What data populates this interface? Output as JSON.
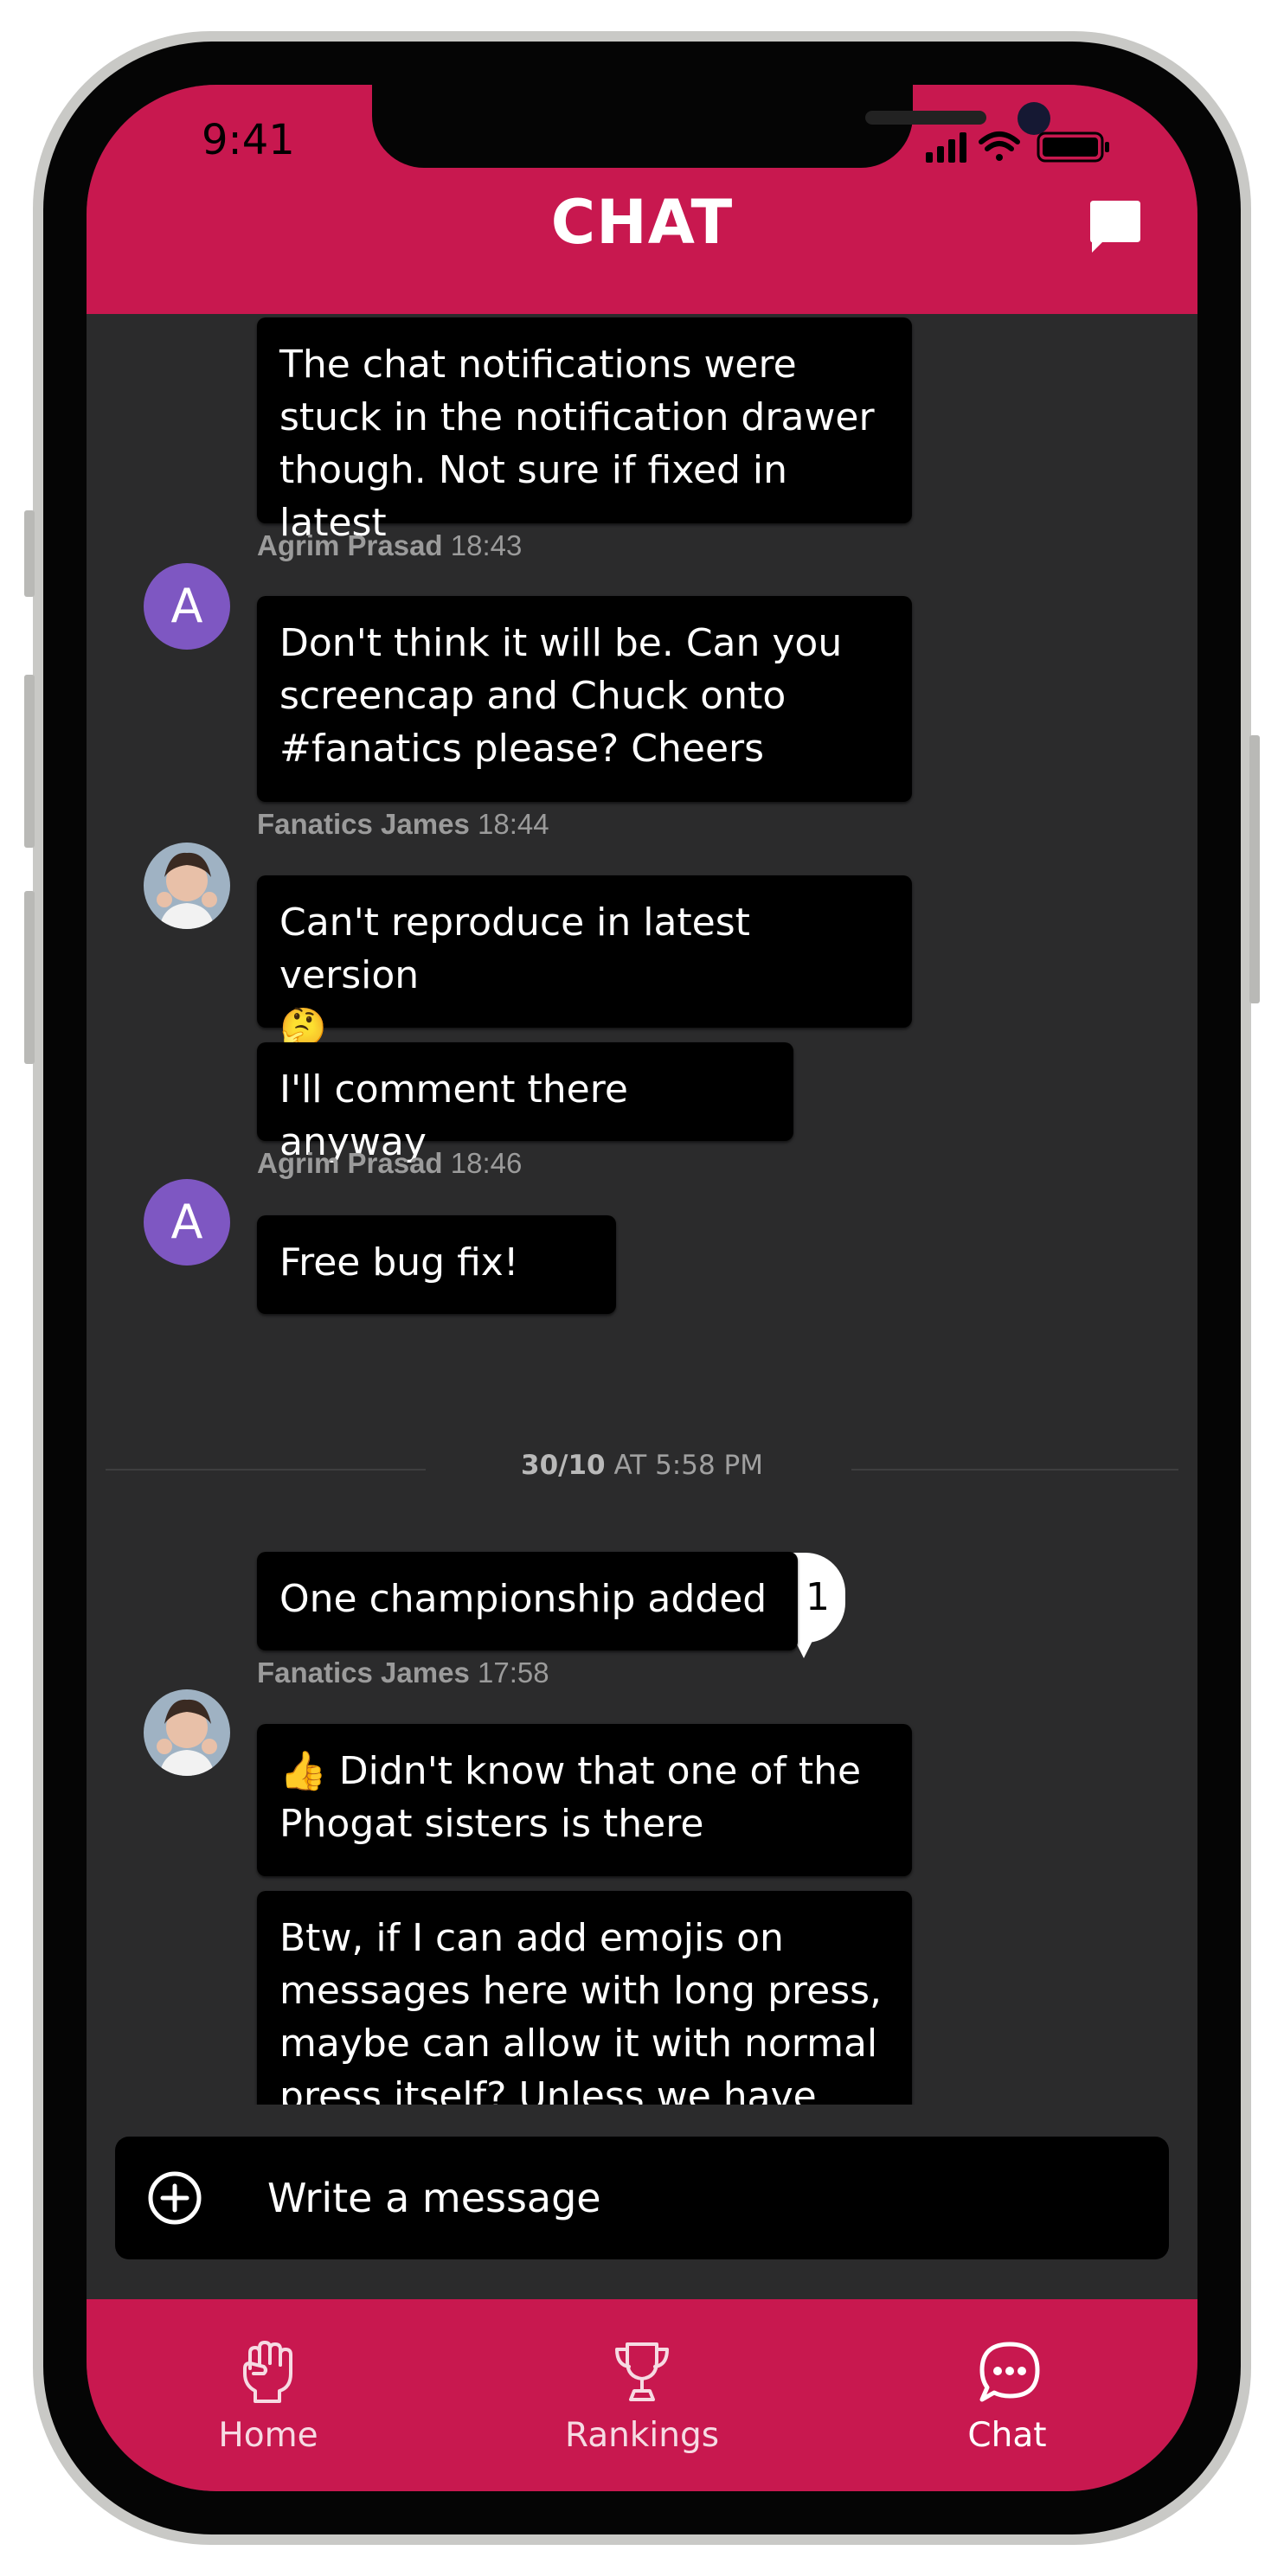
{
  "status_bar": {
    "time": "9:41"
  },
  "header": {
    "title": "CHAT",
    "compose_icon": "chat-bubble-icon"
  },
  "messages": [
    {
      "text": "The chat notifications were stuck in the notification drawer though. Not sure if fixed in latest",
      "lines": [
        "The chat notifications were",
        "stuck in the notification drawer",
        "though. Not sure if fixed in latest"
      ]
    },
    {
      "text": "Don't think it will be. Can you screencap and Chuck onto #fanatics please? Cheers",
      "lines": [
        "Don't think it will be. Can you",
        "screencap and Chuck onto",
        "#fanatics please? Cheers"
      ]
    },
    {
      "text": "Can't reproduce in latest version 🤔",
      "lines": [
        "Can't reproduce in latest version",
        "🤔"
      ]
    },
    {
      "text": "I'll comment there anyway"
    },
    {
      "text": "Free bug fix!"
    },
    {
      "text": "One championship added"
    },
    {
      "text": "👍 Didn't know that one of the Phogat sisters is there",
      "lines": [
        "👍 Didn't know that one of the",
        "Phogat sisters is there"
      ]
    },
    {
      "text": "Btw, if I can add emojis on messages here with long press, maybe can allow it with normal press itself? Unless we have",
      "lines": [
        "Btw, if I can add emojis on",
        "messages here with long press,",
        "maybe can allow it with normal",
        "press itself? Unless we have"
      ]
    }
  ],
  "senders": [
    {
      "name": "Agrim Prasad",
      "time": "18:43",
      "avatar_letter": "A"
    },
    {
      "name": "Fanatics James",
      "time": "18:44",
      "avatar": "user-photo"
    },
    {
      "name": "Agrim Prasad",
      "time": "18:46",
      "avatar_letter": "A"
    },
    {
      "name": "Fanatics James",
      "time": "17:58",
      "avatar": "user-photo"
    }
  ],
  "date_divider": {
    "date": "30/10",
    "time": " AT 5:58 PM"
  },
  "reaction": {
    "emoji": "❤️",
    "count": "1"
  },
  "composer": {
    "placeholder": "Write a message",
    "add_icon": "plus-circle-icon"
  },
  "tabs": [
    {
      "label": "Home",
      "icon": "fist-icon"
    },
    {
      "label": "Rankings",
      "icon": "trophy-icon"
    },
    {
      "label": "Chat",
      "icon": "chat-icon",
      "active": true
    }
  ],
  "colors": {
    "brand": "#c8184f",
    "background": "#2b2b2c",
    "bubble": "#000000",
    "avatar_letter_bg": "#7e57c2",
    "meta_text": "#9b9b9b"
  }
}
